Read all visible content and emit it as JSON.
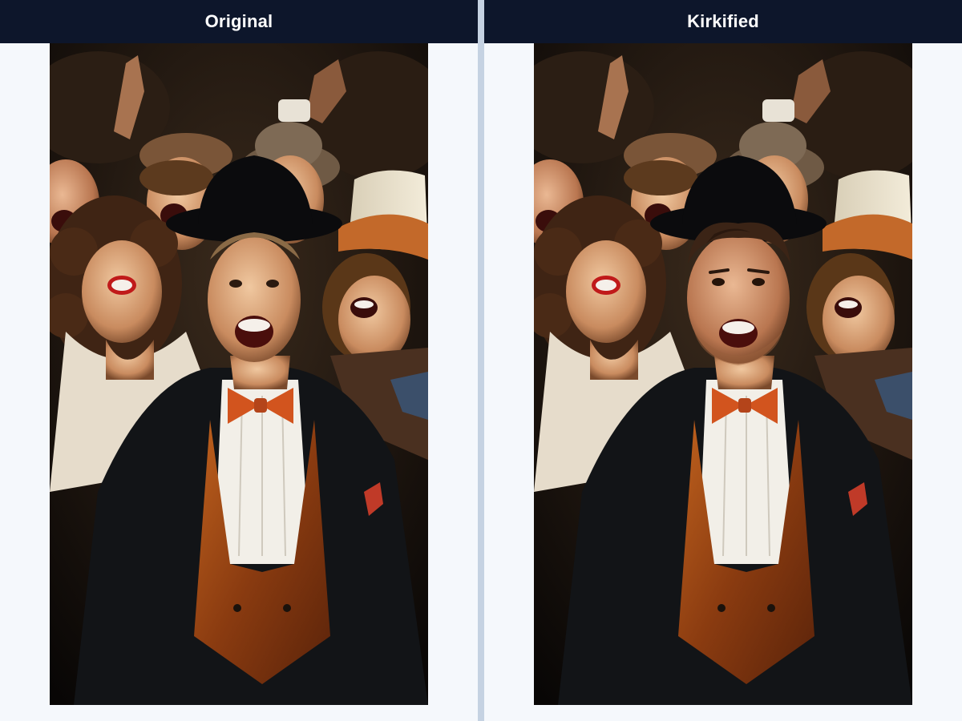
{
  "panels": {
    "original": {
      "label": "Original"
    },
    "kirkified": {
      "label": "Kirkified"
    }
  },
  "colors": {
    "header_bg": "#0d162b",
    "header_text": "#ffffff",
    "page_bg": "#f5f8fc",
    "divider": "#c5d2e2"
  }
}
